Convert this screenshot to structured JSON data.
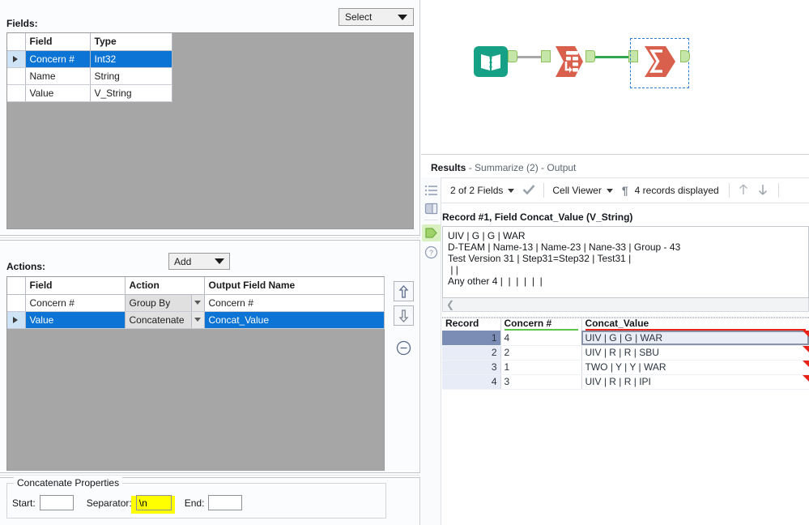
{
  "config_pane": {
    "fields": {
      "label": "Fields:",
      "select_dropdown": {
        "label": "Select",
        "icon": "chevron-down-icon"
      },
      "columns": [
        "",
        "Field",
        "Type"
      ],
      "rows": [
        {
          "field": "Concern #",
          "type": "Int32",
          "selected": true
        },
        {
          "field": "Name",
          "type": "String",
          "selected": false
        },
        {
          "field": "Value",
          "type": "V_String",
          "selected": false
        }
      ]
    },
    "actions": {
      "label": "Actions:",
      "add_dropdown": {
        "label": "Add",
        "icon": "chevron-down-icon"
      },
      "columns": [
        "",
        "Field",
        "Action",
        "Output Field Name"
      ],
      "rows": [
        {
          "field": "Concern #",
          "action": "Group By",
          "output": "Concern #",
          "selected": false
        },
        {
          "field": "Value",
          "action": "Concatenate",
          "output": "Concat_Value",
          "selected": true
        }
      ],
      "buttons": [
        {
          "name": "move-up-button",
          "icon": "arrow-up-icon"
        },
        {
          "name": "move-down-button",
          "icon": "arrow-down-icon"
        },
        {
          "name": "remove-action-button",
          "icon": "minus-circle-icon"
        }
      ]
    },
    "concat_properties": {
      "title": "Concatenate Properties",
      "start_label": "Start:",
      "start_value": "",
      "separator_label": "Separator:",
      "separator_value": "\\n",
      "separator_highlight_color": "#ffff00",
      "end_label": "End:",
      "end_value": ""
    }
  },
  "canvas": {
    "nodes": [
      {
        "name": "text-input-tool",
        "icon": "book-icon",
        "color": "#16a085",
        "selected": false
      },
      {
        "name": "transpose-tool",
        "icon": "transpose-icon",
        "color": "#d9604c",
        "selected": false
      },
      {
        "name": "summarize-tool",
        "icon": "sigma-icon",
        "color": "#d9604c",
        "selected": true
      }
    ],
    "connections": [
      {
        "from": "text-input-tool",
        "to": "transpose-tool",
        "color": "#a8a8a8"
      },
      {
        "from": "transpose-tool",
        "to": "summarize-tool",
        "color": "#2fa84f"
      }
    ]
  },
  "results": {
    "title_bold": "Results",
    "title_sub": " - Summarize (2) - Output",
    "toolbar": {
      "fields_label": "2 of 2 Fields",
      "check_icon": "checkmark-icon",
      "view_mode": "Cell Viewer",
      "pilcrow_icon": "pilcrow-icon",
      "records_label": "4 records displayed",
      "prev_icon": "arrow-up-icon",
      "next_icon": "arrow-down-icon"
    },
    "rail_icons": [
      "list-view-icon",
      "panel-layout-icon",
      "output-anchor-icon",
      "help-icon"
    ],
    "cell_viewer": {
      "header": "Record #1, Field Concat_Value (V_String)",
      "content": "UIV | G | G | WAR\nD-TEAM | Name-13 | Name-23 | Nane-33 | Group - 43\nTest Version 31 | Step31=Step32 | Test31 |\n | |\nAny other 4 |  |  |  |  |  |",
      "scroll_icon": "chevron-left-icon"
    },
    "grid": {
      "columns": [
        {
          "label": "Record",
          "type_color": ""
        },
        {
          "label": "Concern #",
          "type_color": "#5cc44a"
        },
        {
          "label": "Concat_Value",
          "type_color": "#e8241a"
        }
      ],
      "rows": [
        {
          "record": "1",
          "concern": "4",
          "value": "UIV | G | G | WAR",
          "selected": true
        },
        {
          "record": "2",
          "concern": "2",
          "value": "UIV | R | R | SBU",
          "selected": false
        },
        {
          "record": "3",
          "concern": "1",
          "value": "TWO | Y | Y | WAR",
          "selected": false
        },
        {
          "record": "4",
          "concern": "3",
          "value": "UIV | R | R | IPI",
          "selected": false
        }
      ]
    }
  }
}
